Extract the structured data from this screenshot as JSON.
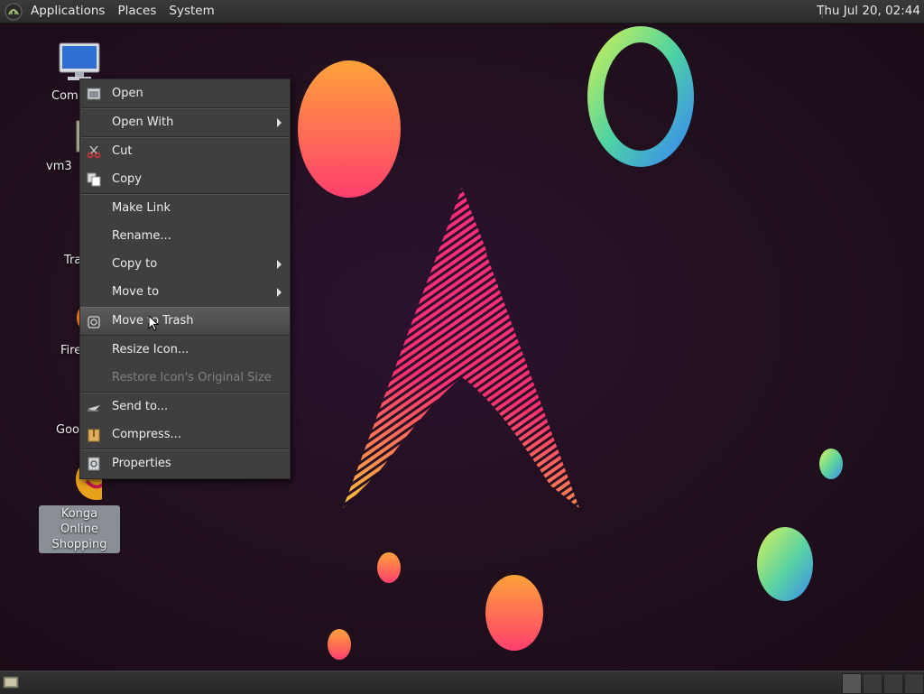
{
  "top_panel": {
    "menus": [
      "Applications",
      "Places",
      "System"
    ],
    "clock": "Thu Jul 20, 02:44"
  },
  "desktop_icons": {
    "computer": "Com",
    "home": "vm3",
    "trash": "Tra",
    "firefox": "Fire",
    "google": "Goo",
    "konga": "Konga Online Shopping"
  },
  "context_menu": {
    "items": [
      {
        "label": "Open",
        "icon": "open-icon"
      },
      {
        "label": "Open With",
        "submenu": true
      },
      {
        "label": "Cut",
        "icon": "scissors-icon"
      },
      {
        "label": "Copy",
        "icon": "copy-icon"
      },
      {
        "label": "Make Link"
      },
      {
        "label": "Rename..."
      },
      {
        "label": "Copy to",
        "submenu": true
      },
      {
        "label": "Move to",
        "submenu": true
      },
      {
        "label": "Move to Trash",
        "icon": "trash-icon",
        "state": "highlighted"
      },
      {
        "label": "Resize Icon..."
      },
      {
        "label": "Restore Icon's Original Size",
        "state": "disabled"
      },
      {
        "label": "Send to...",
        "icon": "send-icon"
      },
      {
        "label": "Compress...",
        "icon": "archive-icon"
      },
      {
        "label": "Properties",
        "icon": "properties-icon"
      }
    ]
  },
  "colors": {
    "panel": "#2f2f2f",
    "menu_bg": "#3f3f3f",
    "desktop_bg": "#22101f",
    "arch_logo": "#ff2d7a"
  }
}
